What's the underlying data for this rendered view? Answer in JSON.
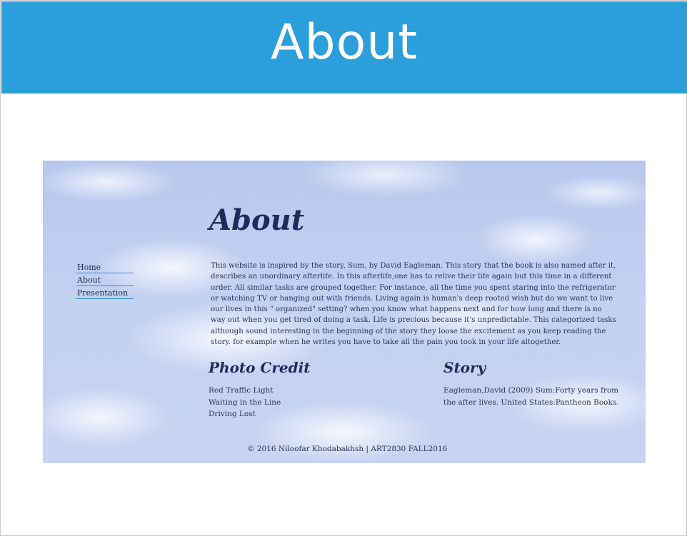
{
  "header": {
    "title": "About"
  },
  "main": {
    "heading": "About",
    "nav": [
      {
        "label": "Home"
      },
      {
        "label": "About"
      },
      {
        "label": "Presentation"
      }
    ],
    "intro": "This website is inspired by the story, Sum, by David Eagleman. This story that the book is also named after it, describes an unordinary afterlife. In this afterlife,one has to relive their life again but this time in a different order. All similar tasks are grouped together. For instance, all the time you spent staring into the refrigerator or watching TV or hanging out with friends. Living again is human's deep rooted wish but do we want to live our lives in this \" organized\" setting? when you know what happens next and for how long and there is no way out when you get tired of doing a task. Life is precious because it's unpredictable. This categorized tasks although sound interesting in the beginning of the story they loose the excitement as you keep reading the story. for example when he writes you have to take all the pain you took in your life altogether.",
    "photo_credit": {
      "title": "Photo Credit",
      "items": [
        "Red Traffic Light",
        "Waiting in the Line",
        "Driving Lost"
      ]
    },
    "story": {
      "title": "Story",
      "text": "Eagleman,David (2009) Sum:Forty years from the after lives. United States:Pantheon Books."
    },
    "footer": "© 2016 Niloofar Khodabakhsh | ART2830 FALL2016"
  }
}
